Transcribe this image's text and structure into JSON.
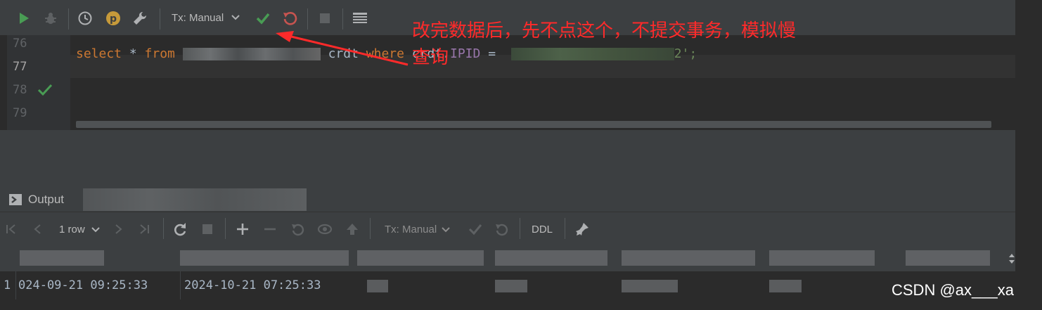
{
  "toolbar": {
    "tx_mode": "Tx: Manual",
    "icons": [
      "run-icon",
      "debug-icon",
      "history-icon",
      "parameters-icon",
      "settings-wrench-icon",
      "commit-check-icon",
      "rollback-icon",
      "stop-icon",
      "table-view-icon"
    ]
  },
  "editor": {
    "lines": [
      {
        "number": "76",
        "text": ""
      },
      {
        "number": "77",
        "text": ""
      },
      {
        "number": "78",
        "text": ""
      },
      {
        "number": "79",
        "text": ""
      }
    ],
    "sql": {
      "kw_select": "select",
      "star": " * ",
      "kw_from": "from",
      "alias": " crdt ",
      "kw_where": "where",
      "field_prefix": " crdt.",
      "field": "IPID",
      "op": " = ",
      "string_tail": "2';"
    }
  },
  "annotation": {
    "line1": "改完数据后，先不点这个，不提交事务，模拟慢",
    "line2": "查询",
    "color": "#ff2a2a"
  },
  "output": {
    "title": "Output",
    "row_count": "1 row",
    "tx_mode": "Tx: Manual",
    "ddl_label": "DDL",
    "row": {
      "number": "1",
      "col1": "024-09-21 09:25:33",
      "col2": "2024-10-21 07:25:33"
    }
  },
  "watermark": "CSDN @ax___xa"
}
